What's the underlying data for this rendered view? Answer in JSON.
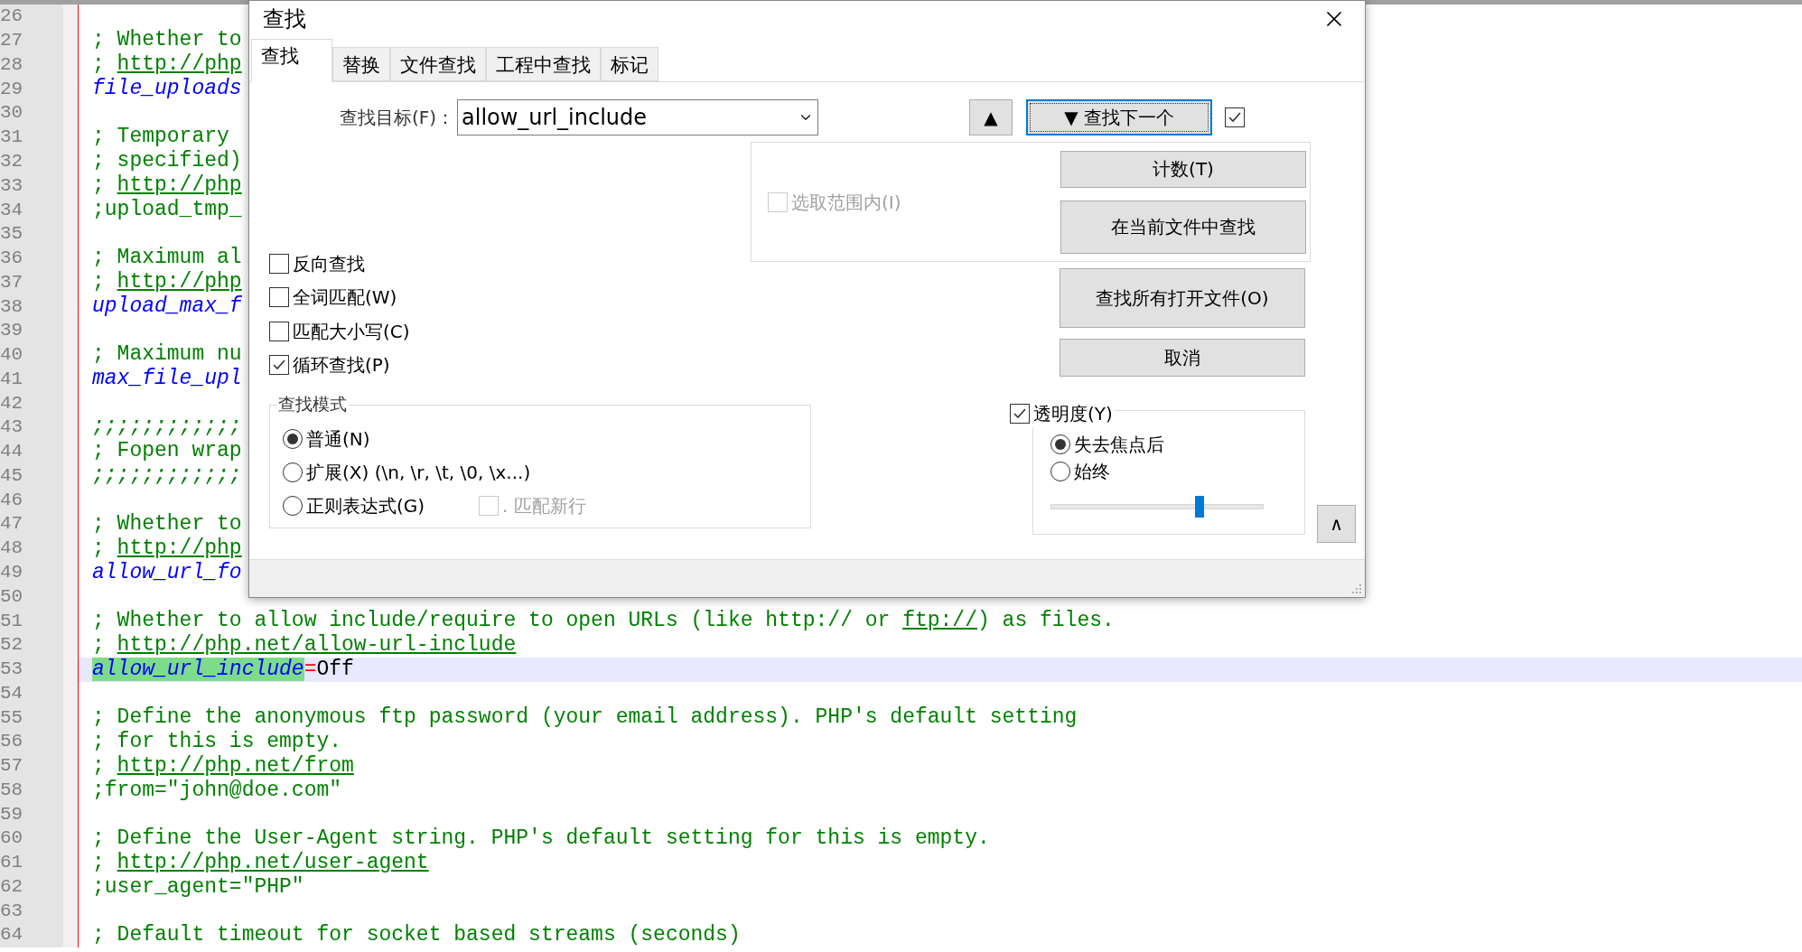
{
  "editor": {
    "lines": [
      {
        "number": "26",
        "current": false
      },
      {
        "number": "27",
        "current": false,
        "segments": [
          {
            "kind": "comment",
            "text": "; Whether to",
            "matched": false
          }
        ]
      },
      {
        "number": "28",
        "current": false,
        "segments": [
          {
            "kind": "comment",
            "text": "; ",
            "matched": false
          },
          {
            "kind": "link",
            "text": "http://php",
            "matched": false
          }
        ]
      },
      {
        "number": "29",
        "current": false,
        "segments": [
          {
            "kind": "key",
            "text": "file_uploads",
            "matched": false
          }
        ]
      },
      {
        "number": "30",
        "current": false
      },
      {
        "number": "31",
        "current": false,
        "segments": [
          {
            "kind": "comment",
            "text": "; Temporary",
            "matched": false
          }
        ]
      },
      {
        "number": "32",
        "current": false,
        "segments": [
          {
            "kind": "comment",
            "text": "; specified)",
            "matched": false
          }
        ]
      },
      {
        "number": "33",
        "current": false,
        "segments": [
          {
            "kind": "comment",
            "text": "; ",
            "matched": false
          },
          {
            "kind": "link",
            "text": "http://php",
            "matched": false
          }
        ]
      },
      {
        "number": "34",
        "current": false,
        "segments": [
          {
            "kind": "comment",
            "text": ";upload_tmp_",
            "matched": false
          }
        ]
      },
      {
        "number": "35",
        "current": false
      },
      {
        "number": "36",
        "current": false,
        "segments": [
          {
            "kind": "comment",
            "text": "; Maximum al",
            "matched": false
          }
        ]
      },
      {
        "number": "37",
        "current": false,
        "segments": [
          {
            "kind": "comment",
            "text": "; ",
            "matched": false
          },
          {
            "kind": "link",
            "text": "http://php",
            "matched": false
          }
        ]
      },
      {
        "number": "38",
        "current": false,
        "segments": [
          {
            "kind": "key",
            "text": "upload_max_f",
            "matched": false
          }
        ]
      },
      {
        "number": "39",
        "current": false
      },
      {
        "number": "40",
        "current": false,
        "segments": [
          {
            "kind": "comment",
            "text": "; Maximum nu",
            "matched": false
          }
        ]
      },
      {
        "number": "41",
        "current": false,
        "segments": [
          {
            "kind": "key",
            "text": "max_file_upl",
            "matched": false
          }
        ]
      },
      {
        "number": "42",
        "current": false
      },
      {
        "number": "43",
        "current": false,
        "segments": [
          {
            "kind": "section",
            "text": ";;;;;;;;;;;;",
            "matched": false
          }
        ]
      },
      {
        "number": "44",
        "current": false,
        "segments": [
          {
            "kind": "comment",
            "text": "; Fopen wrap",
            "matched": false
          }
        ]
      },
      {
        "number": "45",
        "current": false,
        "segments": [
          {
            "kind": "section",
            "text": ";;;;;;;;;;;;",
            "matched": false
          }
        ]
      },
      {
        "number": "46",
        "current": false
      },
      {
        "number": "47",
        "current": false,
        "segments": [
          {
            "kind": "comment",
            "text": "; Whether to",
            "matched": false
          }
        ]
      },
      {
        "number": "48",
        "current": false,
        "segments": [
          {
            "kind": "comment",
            "text": "; ",
            "matched": false
          },
          {
            "kind": "link",
            "text": "http://php",
            "matched": false
          }
        ]
      },
      {
        "number": "49",
        "current": false,
        "segments": [
          {
            "kind": "key",
            "text": "allow_url_fo",
            "matched": false
          }
        ]
      },
      {
        "number": "50",
        "current": false
      },
      {
        "number": "51",
        "current": false,
        "segments": [
          {
            "kind": "comment",
            "text": "; Whether to allow include/require to open URLs (like http:// or ",
            "matched": false
          },
          {
            "kind": "link",
            "text": "ftp://",
            "matched": false
          },
          {
            "kind": "comment",
            "text": ") as files.",
            "matched": false
          }
        ]
      },
      {
        "number": "52",
        "current": false,
        "segments": [
          {
            "kind": "comment",
            "text": "; ",
            "matched": false
          },
          {
            "kind": "link",
            "text": "http://php.net/allow-url-include",
            "matched": false
          }
        ]
      },
      {
        "number": "53",
        "current": true,
        "segments": [
          {
            "kind": "key",
            "text": "allow_url_include",
            "matched": true
          },
          {
            "kind": "operator",
            "text": "=",
            "matched": false
          },
          {
            "kind": "value",
            "text": "Off",
            "matched": false
          }
        ]
      },
      {
        "number": "54",
        "current": false
      },
      {
        "number": "55",
        "current": false,
        "segments": [
          {
            "kind": "comment",
            "text": "; Define the anonymous ftp password (your email address). PHP's default setting",
            "matched": false
          }
        ]
      },
      {
        "number": "56",
        "current": false,
        "segments": [
          {
            "kind": "comment",
            "text": "; for this is empty.",
            "matched": false
          }
        ]
      },
      {
        "number": "57",
        "current": false,
        "segments": [
          {
            "kind": "comment",
            "text": "; ",
            "matched": false
          },
          {
            "kind": "link",
            "text": "http://php.net/from",
            "matched": false
          }
        ]
      },
      {
        "number": "58",
        "current": false,
        "segments": [
          {
            "kind": "comment",
            "text": ";from=\"john@doe.com\"",
            "matched": false
          }
        ]
      },
      {
        "number": "59",
        "current": false
      },
      {
        "number": "60",
        "current": false,
        "segments": [
          {
            "kind": "comment",
            "text": "; Define the User-Agent string. PHP's default setting for this is empty.",
            "matched": false
          }
        ]
      },
      {
        "number": "61",
        "current": false,
        "segments": [
          {
            "kind": "comment",
            "text": "; ",
            "matched": false
          },
          {
            "kind": "link",
            "text": "http://php.net/user-agent",
            "matched": false
          }
        ]
      },
      {
        "number": "62",
        "current": false,
        "segments": [
          {
            "kind": "comment",
            "text": ";user_agent=\"PHP\"",
            "matched": false
          }
        ]
      },
      {
        "number": "63",
        "current": false
      },
      {
        "number": "64",
        "current": false,
        "segments": [
          {
            "kind": "comment",
            "text": "; Default timeout for socket based streams (seconds)",
            "matched": false
          }
        ]
      }
    ]
  },
  "dialog": {
    "title": "查找",
    "tabs": [
      {
        "label": "查找",
        "selected": true
      },
      {
        "label": "替换",
        "selected": false
      },
      {
        "label": "文件查找",
        "selected": false
      },
      {
        "label": "工程中查找",
        "selected": false
      },
      {
        "label": "标记",
        "selected": false
      }
    ],
    "find_what": {
      "label": "查找目标(F)：",
      "value": "allow_url_include"
    },
    "up_button": "▲",
    "find_next_button": "▼ 查找下一个",
    "stay_open": {
      "checked": true
    },
    "in_selection": {
      "label": "选取范围内(I)",
      "checked": false,
      "disabled": true
    },
    "count_button": "计数(T)",
    "find_in_current_button": "在当前文件中查找",
    "find_all_open_button": "查找所有打开文件(O)",
    "cancel_button": "取消",
    "options": [
      {
        "label": "反向查找",
        "checked": false
      },
      {
        "label": "全词匹配(W)",
        "checked": false
      },
      {
        "label": "匹配大小写(C)",
        "checked": false
      },
      {
        "label": "循环查找(P)",
        "checked": true
      }
    ],
    "search_mode": {
      "title": "查找模式",
      "options": [
        {
          "label": "普通(N)",
          "selected": true
        },
        {
          "label": "扩展(X) (\\n, \\r, \\t, \\0, \\x...)",
          "selected": false
        },
        {
          "label": "正则表达式(G)",
          "selected": false
        }
      ],
      "dot_newline": {
        "label": ". 匹配新行",
        "checked": false,
        "disabled": true
      }
    },
    "transparency": {
      "label": "透明度(Y)",
      "checked": true,
      "options": [
        {
          "label": "失去焦点后",
          "selected": true
        },
        {
          "label": "始终",
          "selected": false
        }
      ],
      "level": 0.7
    },
    "collapse_button": "∧"
  }
}
